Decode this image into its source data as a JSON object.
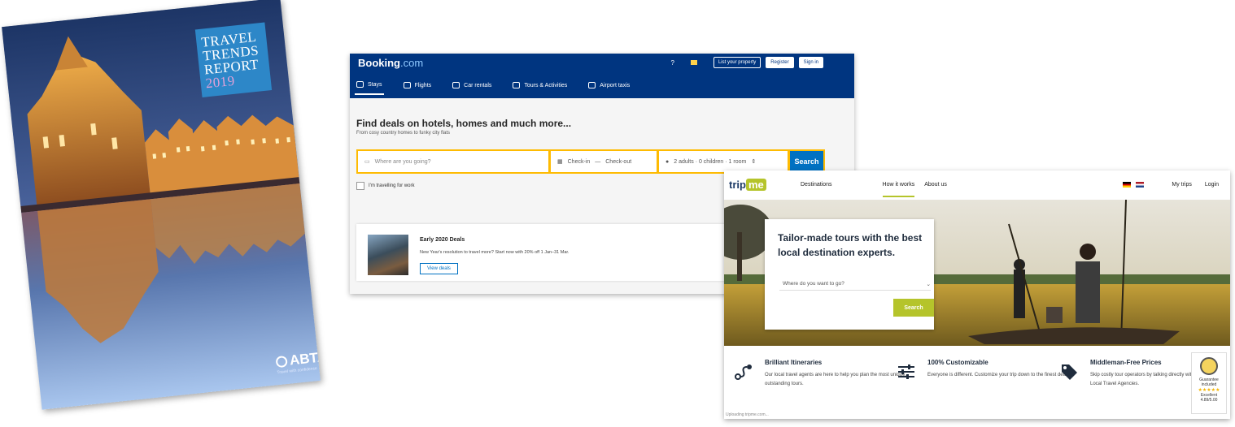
{
  "brochure": {
    "title_lines": [
      "TRAVEL",
      "TRENDS",
      "REPORT"
    ],
    "year": "2019",
    "publisher": "ABTA",
    "publisher_tagline": "Travel with confidence"
  },
  "booking": {
    "logo_main": "Booking",
    "logo_suffix": ".com",
    "help_icon": "question-icon",
    "top_buttons": [
      "List your property",
      "Register",
      "Sign in"
    ],
    "nav": [
      {
        "label": "Stays",
        "icon": "bed-icon",
        "active": true
      },
      {
        "label": "Flights",
        "icon": "plane-icon"
      },
      {
        "label": "Car rentals",
        "icon": "car-icon"
      },
      {
        "label": "Tours & Activities",
        "icon": "ticket-icon"
      },
      {
        "label": "Airport taxis",
        "icon": "taxi-icon"
      }
    ],
    "headline": "Find deals on hotels, homes and much more...",
    "subheadline": "From cosy country homes to funky city flats",
    "search": {
      "destination_placeholder": "Where are you going?",
      "checkin": "Check-in",
      "dash": "—",
      "checkout": "Check-out",
      "guests": "2 adults · 0 children · 1 room",
      "button": "Search"
    },
    "work_travel": "I'm travelling for work",
    "deal": {
      "title": "Early 2020 Deals",
      "desc": "New Year's resolution to travel more? Start now with 20% off 1 Jan–31 Mar.",
      "button": "View deals"
    }
  },
  "trip": {
    "logo_main": "trip",
    "logo_me": "me",
    "nav": [
      "Destinations",
      "How it works",
      "About us"
    ],
    "right": [
      "My trips",
      "Login"
    ],
    "hero": {
      "headline": "Tailor-made tours with the best local destination experts.",
      "select_placeholder": "Where do you want to go?",
      "button": "Search"
    },
    "features": [
      {
        "title": "Brilliant Itineraries",
        "desc": "Our local travel agents are here to help you plan the most unique, outstanding tours.",
        "icon": "route-icon"
      },
      {
        "title": "100% Customizable",
        "desc": "Everyone is different. Customize your trip down to the finest detail.",
        "icon": "sliders-icon"
      },
      {
        "title": "Middleman-Free Prices",
        "desc": "Skip costly tour operators by talking directly with Local Travel Agencies.",
        "icon": "tag-icon"
      }
    ],
    "badge": {
      "line1": "Guarantee",
      "line2": "included",
      "rating": "Excellent",
      "score": "4.89/5.00"
    },
    "status": "Uploading tripme.com..."
  },
  "colors": {
    "booking_blue": "#003580",
    "booking_yellow": "#febb02",
    "booking_cta": "#0071c2",
    "tripme_green": "#b5c42b"
  }
}
